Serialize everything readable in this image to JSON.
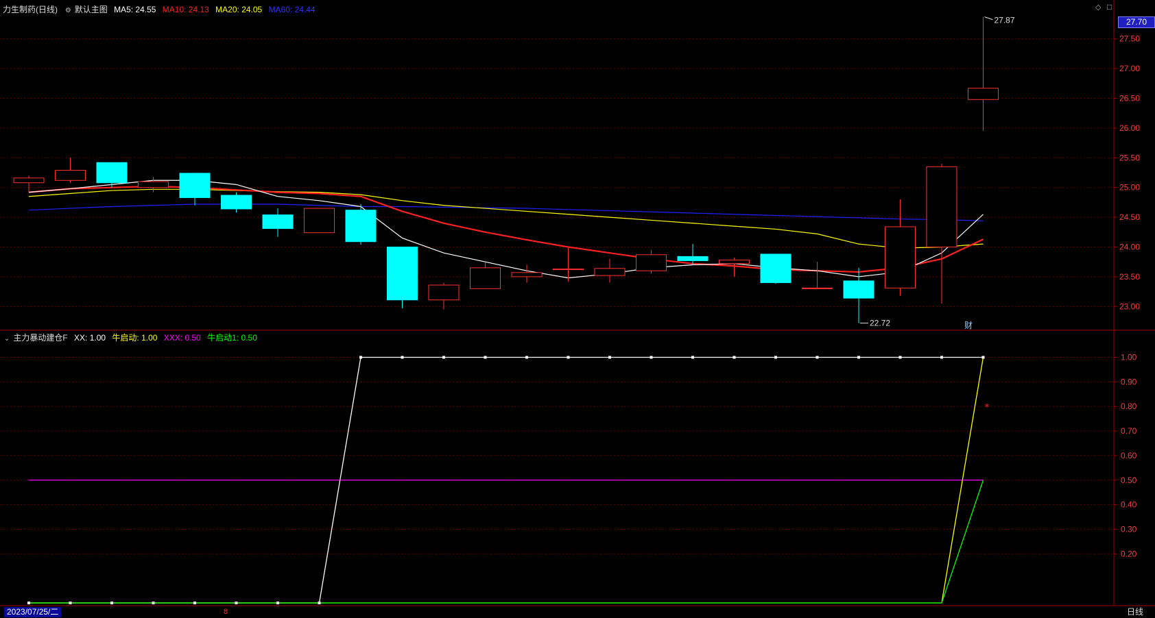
{
  "header": {
    "stock_name": "力生制药",
    "period_tag": "(日线)",
    "template_label": "默认主图",
    "ma5": "MA5: 24.55",
    "ma10": "MA10: 24.13",
    "ma20": "MA20: 24.05",
    "ma60": "MA60: 24.44"
  },
  "indicator_header": {
    "name": "主力暴动建仓F",
    "xx": "XX: 1.00",
    "niu": "牛启动: 1.00",
    "xxx": "XXX: 0.50",
    "niu1": "牛启动1: 0.50"
  },
  "footer": {
    "date": "2023/07/25/二",
    "marker": "8",
    "period": "日线"
  },
  "current_price_tag": "27.70",
  "cai_marker": "财",
  "colors": {
    "up": "#ff3030",
    "down": "#00ffff",
    "ma5": "#ffffff",
    "ma10": "#ff2020",
    "ma20": "#ffff00",
    "ma60": "#2020ff",
    "grid": "#6a0000",
    "axis_text": "#ff3b3b",
    "xx": "#ffffff",
    "niu": "#ffff00",
    "xxx": "#ff00ff",
    "niu1": "#00ff00"
  },
  "chart_data": [
    {
      "type": "candlestick",
      "ylim": [
        22.6,
        27.9
      ],
      "yticks": [
        "23.00",
        "23.50",
        "24.00",
        "24.50",
        "25.00",
        "25.50",
        "26.00",
        "26.50",
        "27.00",
        "27.50"
      ],
      "annotations": {
        "high": "27.87",
        "low": "22.72"
      },
      "candles": [
        {
          "o": 25.08,
          "h": 25.2,
          "l": 24.92,
          "c": 25.16
        },
        {
          "o": 25.12,
          "h": 25.5,
          "l": 25.08,
          "c": 25.29
        },
        {
          "o": 25.42,
          "h": 25.42,
          "l": 25.0,
          "c": 25.08
        },
        {
          "o": 25.0,
          "h": 25.18,
          "l": 24.92,
          "c": 25.1
        },
        {
          "o": 25.24,
          "h": 25.24,
          "l": 24.7,
          "c": 24.83
        },
        {
          "o": 24.87,
          "h": 24.92,
          "l": 24.58,
          "c": 24.64
        },
        {
          "o": 24.54,
          "h": 24.65,
          "l": 24.17,
          "c": 24.31
        },
        {
          "o": 24.24,
          "h": 24.65,
          "l": 24.24,
          "c": 24.65
        },
        {
          "o": 24.62,
          "h": 24.72,
          "l": 24.04,
          "c": 24.09
        },
        {
          "o": 24.0,
          "h": 24.0,
          "l": 22.97,
          "c": 23.11
        },
        {
          "o": 23.11,
          "h": 23.4,
          "l": 22.95,
          "c": 23.36
        },
        {
          "o": 23.3,
          "h": 23.75,
          "l": 23.3,
          "c": 23.65
        },
        {
          "o": 23.5,
          "h": 23.7,
          "l": 23.4,
          "c": 23.57
        },
        {
          "o": 23.63,
          "h": 24.0,
          "l": 23.42,
          "c": 23.63
        },
        {
          "o": 23.52,
          "h": 23.8,
          "l": 23.4,
          "c": 23.64
        },
        {
          "o": 23.6,
          "h": 23.95,
          "l": 23.55,
          "c": 23.87
        },
        {
          "o": 23.84,
          "h": 24.05,
          "l": 23.7,
          "c": 23.77
        },
        {
          "o": 23.72,
          "h": 23.82,
          "l": 23.5,
          "c": 23.78
        },
        {
          "o": 23.88,
          "h": 23.88,
          "l": 23.38,
          "c": 23.4
        },
        {
          "o": 23.31,
          "h": 23.75,
          "l": 23.31,
          "c": 23.31
        },
        {
          "o": 23.43,
          "h": 23.65,
          "l": 22.72,
          "c": 23.14
        },
        {
          "o": 23.31,
          "h": 24.8,
          "l": 23.18,
          "c": 24.34
        },
        {
          "o": 24.0,
          "h": 25.4,
          "l": 23.05,
          "c": 25.35
        },
        {
          "o": 26.48,
          "h": 27.87,
          "l": 25.95,
          "c": 26.67
        }
      ],
      "ma5": [
        24.92,
        24.98,
        25.05,
        25.12,
        25.12,
        25.05,
        24.85,
        24.78,
        24.68,
        24.15,
        23.9,
        23.75,
        23.6,
        23.48,
        23.55,
        23.65,
        23.7,
        23.72,
        23.65,
        23.6,
        23.5,
        23.58,
        23.9,
        24.55
      ],
      "ma10": [
        24.92,
        24.98,
        25.0,
        25.02,
        25.0,
        24.96,
        24.92,
        24.9,
        24.85,
        24.6,
        24.4,
        24.25,
        24.12,
        24.0,
        23.9,
        23.8,
        23.72,
        23.68,
        23.62,
        23.6,
        23.58,
        23.65,
        23.8,
        24.13
      ],
      "ma20": [
        24.85,
        24.9,
        24.95,
        24.97,
        24.97,
        24.95,
        24.93,
        24.92,
        24.88,
        24.78,
        24.7,
        24.65,
        24.6,
        24.55,
        24.5,
        24.45,
        24.4,
        24.35,
        24.3,
        24.22,
        24.05,
        23.98,
        24.0,
        24.05
      ],
      "ma60": [
        24.62,
        24.65,
        24.68,
        24.7,
        24.72,
        24.72,
        24.72,
        24.7,
        24.68,
        24.68,
        24.67,
        24.66,
        24.65,
        24.63,
        24.61,
        24.59,
        24.57,
        24.55,
        24.53,
        24.51,
        24.49,
        24.47,
        24.46,
        24.44
      ]
    },
    {
      "type": "line",
      "ylim": [
        0,
        1.06
      ],
      "yticks": [
        "0.20",
        "0.30",
        "0.40",
        "0.50",
        "0.60",
        "0.70",
        "0.80",
        "0.90",
        "1.00"
      ],
      "series": [
        {
          "name": "XX",
          "values": [
            0,
            0,
            0,
            0,
            0,
            0,
            0,
            0,
            1,
            1,
            1,
            1,
            1,
            1,
            1,
            1,
            1,
            1,
            1,
            1,
            1,
            1,
            1,
            1
          ]
        },
        {
          "name": "牛启动",
          "values": [
            0,
            0,
            0,
            0,
            0,
            0,
            0,
            0,
            0,
            0,
            0,
            0,
            0,
            0,
            0,
            0,
            0,
            0,
            0,
            0,
            0,
            0,
            0,
            1
          ]
        },
        {
          "name": "XXX",
          "values": [
            0.5,
            0.5,
            0.5,
            0.5,
            0.5,
            0.5,
            0.5,
            0.5,
            0.5,
            0.5,
            0.5,
            0.5,
            0.5,
            0.5,
            0.5,
            0.5,
            0.5,
            0.5,
            0.5,
            0.5,
            0.5,
            0.5,
            0.5,
            0.5
          ]
        },
        {
          "name": "牛启动1",
          "values": [
            0,
            0,
            0,
            0,
            0,
            0,
            0,
            0,
            0,
            0,
            0,
            0,
            0,
            0,
            0,
            0,
            0,
            0,
            0,
            0,
            0,
            0,
            0,
            0.5
          ]
        }
      ],
      "star_value": 0.8
    }
  ]
}
